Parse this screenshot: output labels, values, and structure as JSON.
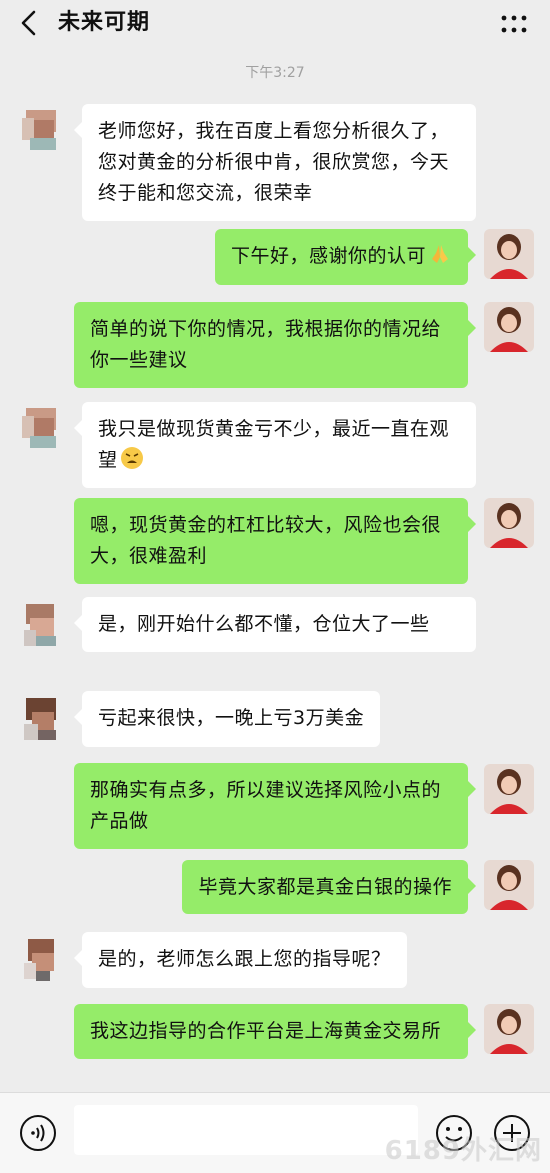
{
  "header": {
    "title": "未来可期"
  },
  "timestamp": "下午3:27",
  "messages": [
    {
      "from": "them",
      "text": "老师您好，我在百度上看您分析很久了，您对黄金的分析很中肯，很欣赏您，今天终于能和您交流，很荣幸"
    },
    {
      "from": "me",
      "text": "下午好，感谢你的认可",
      "emoji": "folded-hands"
    },
    {
      "from": "me",
      "text": "简单的说下你的情况，我根据你的情况给你一些建议"
    },
    {
      "from": "them",
      "text": "我只是做现货黄金亏不少，最近一直在观望",
      "emoji": "tired-face"
    },
    {
      "from": "me",
      "text": "嗯，现货黄金的杠杠比较大，风险也会很大，很难盈利"
    },
    {
      "from": "them",
      "text": "是，刚开始什么都不懂，仓位大了一些"
    },
    {
      "from": "them",
      "text": "亏起来很快，一晚上亏3万美金"
    },
    {
      "from": "me",
      "text": "那确实有点多，所以建议选择风险小点的产品做"
    },
    {
      "from": "me",
      "text": "毕竟大家都是真金白银的操作"
    },
    {
      "from": "them",
      "text": "是的，老师怎么跟上您的指导呢？"
    },
    {
      "from": "me",
      "text": "我这边指导的合作平台是上海黄金交易所"
    }
  ],
  "watermark": "6189外汇网",
  "colors": {
    "background": "#ededed",
    "incoming": "#ffffff",
    "outgoing": "#95ec69"
  }
}
